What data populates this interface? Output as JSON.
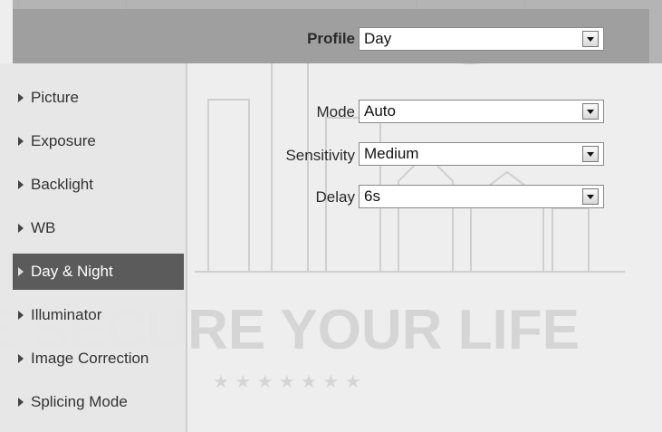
{
  "profile": {
    "label": "Profile",
    "value": "Day"
  },
  "sidebar": {
    "items": [
      {
        "label": "Picture",
        "active": false
      },
      {
        "label": "Exposure",
        "active": false
      },
      {
        "label": "Backlight",
        "active": false
      },
      {
        "label": "WB",
        "active": false
      },
      {
        "label": "Day & Night",
        "active": true
      },
      {
        "label": "Illuminator",
        "active": false
      },
      {
        "label": "Image Correction",
        "active": false
      },
      {
        "label": "Splicing Mode",
        "active": false
      }
    ]
  },
  "form": {
    "mode": {
      "label": "Mode",
      "value": "Auto"
    },
    "sensitivity": {
      "label": "Sensitivity",
      "value": "Medium"
    },
    "delay": {
      "label": "Delay",
      "value": "6s"
    }
  },
  "watermark": {
    "slogan": "WE SECURE YOUR LIFE"
  },
  "colors": {
    "active_item_bg": "#5b5b5b",
    "header_bg": "#9f9f9f"
  }
}
